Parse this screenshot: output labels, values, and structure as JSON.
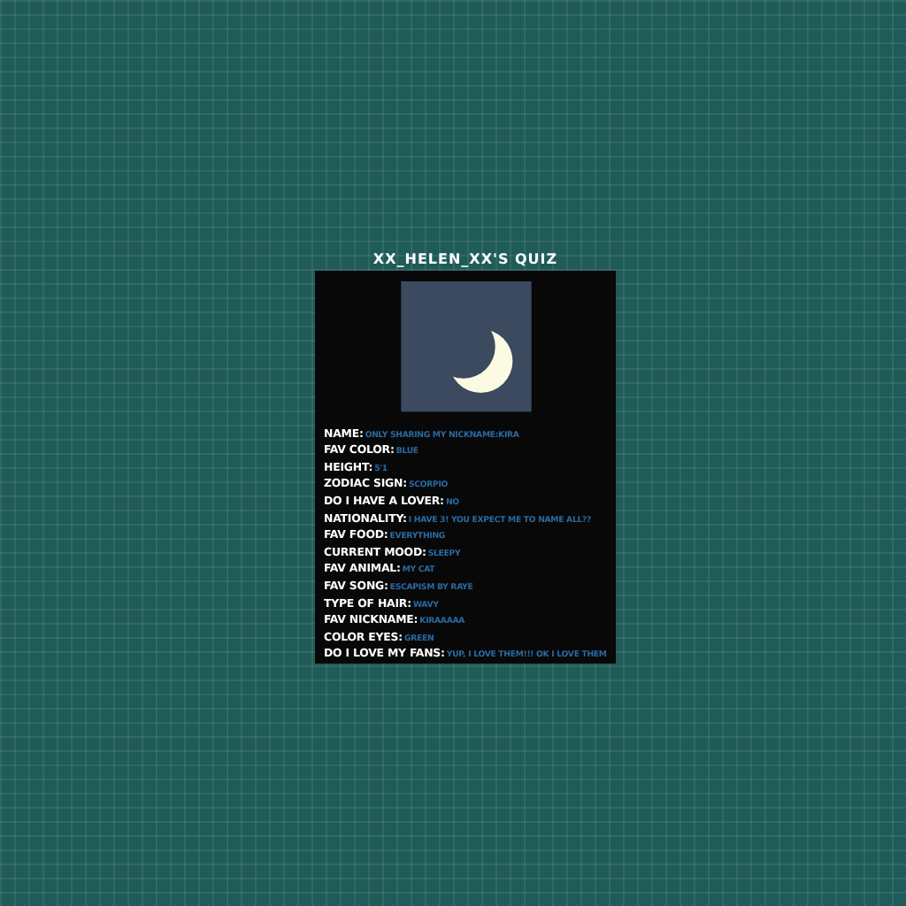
{
  "title": "XX_HELEN_XX'S QUIZ",
  "rows": [
    {
      "label": "NAME:",
      "value": "ONLY SHARING MY NICKNAME:KIRA"
    },
    {
      "label": "FAV COLOR:",
      "value": "BLUE"
    },
    {
      "label": "HEIGHT:",
      "value": "5'1"
    },
    {
      "label": "ZODIAC SIGN:",
      "value": "SCORPIO"
    },
    {
      "label": "DO I HAVE A LOVER:",
      "value": "NO"
    },
    {
      "label": "NATIONALITY:",
      "value": "I HAVE 3! YOU EXPECT ME TO NAME ALL??"
    },
    {
      "label": "FAV FOOD:",
      "value": "EVERYTHING"
    },
    {
      "label": "CURRENT MOOD:",
      "value": "SLEEPY"
    },
    {
      "label": "FAV ANIMAL:",
      "value": "MY CAT"
    },
    {
      "label": "FAV SONG:",
      "value": "ESCAPISM BY RAYE"
    },
    {
      "label": "TYPE OF HAIR:",
      "value": "WAVY"
    },
    {
      "label": "FAV NICKNAME:",
      "value": "KIRAAAAA"
    },
    {
      "label": "COLOR EYES:",
      "value": "GREEN"
    },
    {
      "label": "DO I LOVE MY FANS:",
      "value": "YUP, I LOVE THEM!!! OK I LOVE THEM"
    }
  ]
}
